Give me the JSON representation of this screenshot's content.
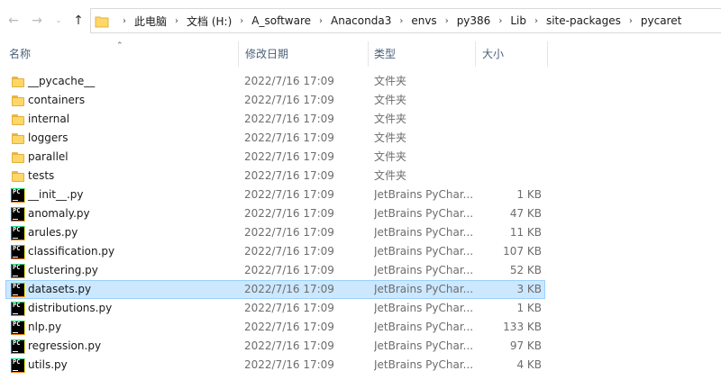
{
  "nav": {
    "back_icon": "arrow-left-icon",
    "forward_icon": "arrow-right-icon",
    "recent_icon": "chevron-down-icon",
    "up_icon": "arrow-up-icon"
  },
  "breadcrumb": [
    "此电脑",
    "文档 (H:)",
    "A_software",
    "Anaconda3",
    "envs",
    "py386",
    "Lib",
    "site-packages",
    "pycaret"
  ],
  "columns": {
    "name": "名称",
    "date": "修改日期",
    "type": "类型",
    "size": "大小"
  },
  "files": [
    {
      "name": "__pycache__",
      "date": "2022/7/16 17:09",
      "type": "文件夹",
      "size": "",
      "icon": "folder-icon"
    },
    {
      "name": "containers",
      "date": "2022/7/16 17:09",
      "type": "文件夹",
      "size": "",
      "icon": "folder-icon"
    },
    {
      "name": "internal",
      "date": "2022/7/16 17:09",
      "type": "文件夹",
      "size": "",
      "icon": "folder-icon"
    },
    {
      "name": "loggers",
      "date": "2022/7/16 17:09",
      "type": "文件夹",
      "size": "",
      "icon": "folder-icon"
    },
    {
      "name": "parallel",
      "date": "2022/7/16 17:09",
      "type": "文件夹",
      "size": "",
      "icon": "folder-icon"
    },
    {
      "name": "tests",
      "date": "2022/7/16 17:09",
      "type": "文件夹",
      "size": "",
      "icon": "folder-icon"
    },
    {
      "name": "__init__.py",
      "date": "2022/7/16 17:09",
      "type": "JetBrains PyChar...",
      "size": "1 KB",
      "icon": "pycharm-file-icon"
    },
    {
      "name": "anomaly.py",
      "date": "2022/7/16 17:09",
      "type": "JetBrains PyChar...",
      "size": "47 KB",
      "icon": "pycharm-file-icon"
    },
    {
      "name": "arules.py",
      "date": "2022/7/16 17:09",
      "type": "JetBrains PyChar...",
      "size": "11 KB",
      "icon": "pycharm-file-icon"
    },
    {
      "name": "classification.py",
      "date": "2022/7/16 17:09",
      "type": "JetBrains PyChar...",
      "size": "107 KB",
      "icon": "pycharm-file-icon"
    },
    {
      "name": "clustering.py",
      "date": "2022/7/16 17:09",
      "type": "JetBrains PyChar...",
      "size": "52 KB",
      "icon": "pycharm-file-icon"
    },
    {
      "name": "datasets.py",
      "date": "2022/7/16 17:09",
      "type": "JetBrains PyChar...",
      "size": "3 KB",
      "icon": "pycharm-file-icon",
      "selected": true
    },
    {
      "name": "distributions.py",
      "date": "2022/7/16 17:09",
      "type": "JetBrains PyChar...",
      "size": "1 KB",
      "icon": "pycharm-file-icon"
    },
    {
      "name": "nlp.py",
      "date": "2022/7/16 17:09",
      "type": "JetBrains PyChar...",
      "size": "133 KB",
      "icon": "pycharm-file-icon"
    },
    {
      "name": "regression.py",
      "date": "2022/7/16 17:09",
      "type": "JetBrains PyChar...",
      "size": "97 KB",
      "icon": "pycharm-file-icon"
    },
    {
      "name": "utils.py",
      "date": "2022/7/16 17:09",
      "type": "JetBrains PyChar...",
      "size": "4 KB",
      "icon": "pycharm-file-icon"
    }
  ],
  "colors": {
    "selection_bg": "#cce8ff",
    "selection_border": "#99d1ff",
    "header_text": "#4c607a",
    "folder": "#ffd767"
  }
}
